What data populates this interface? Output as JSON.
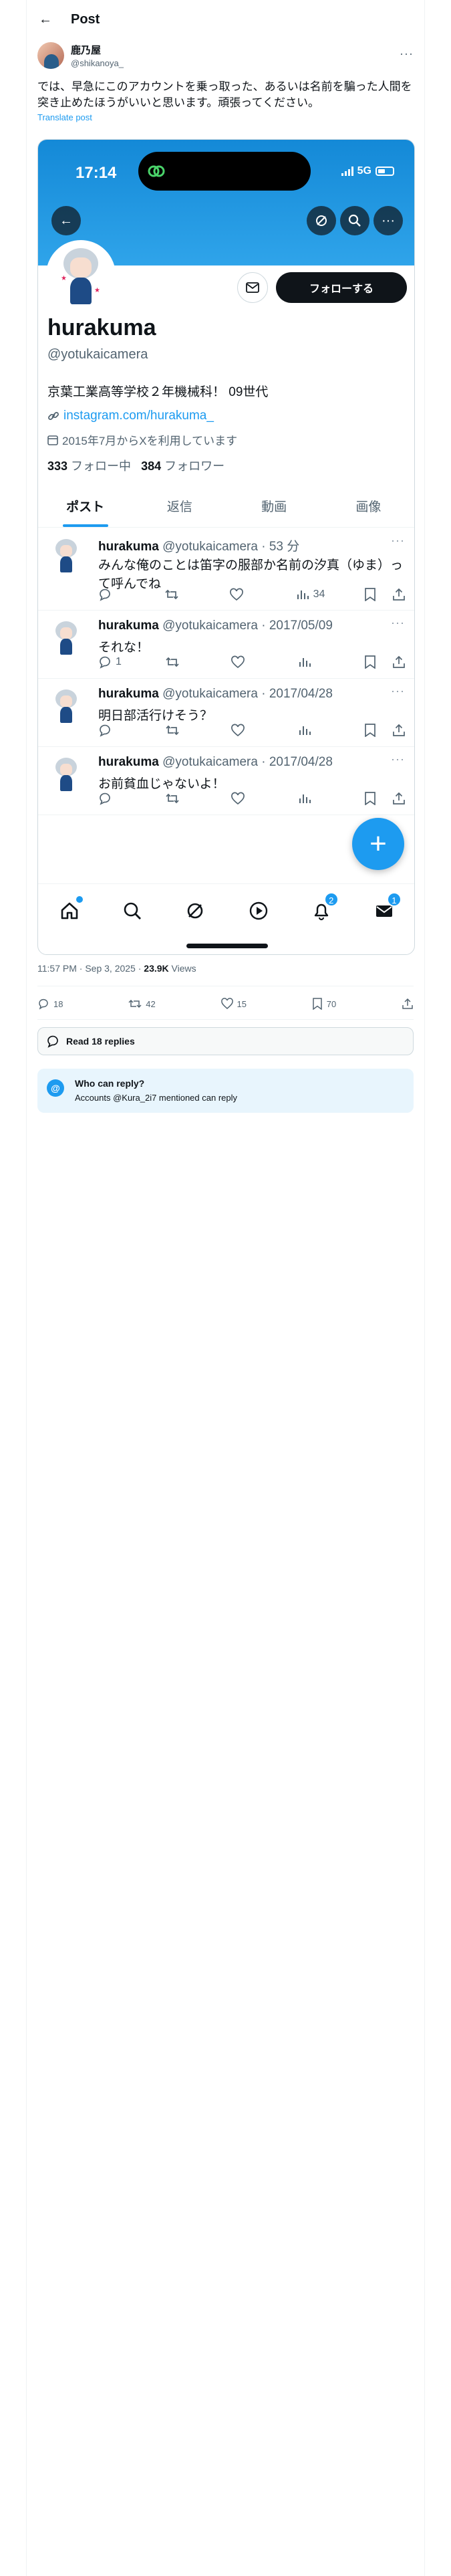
{
  "header": {
    "title": "Post"
  },
  "author": {
    "display_name": "鹿乃屋",
    "username": "@shikanoya_"
  },
  "post": {
    "text": "では、早急にこのアカウントを乗っ取った、あるいは名前を騙った人間を突き止めたほうがいいと思います。頑張ってください。",
    "translate_label": "Translate post",
    "timestamp": "11:57 PM · Sep 3, 2025 · ",
    "views_count": "23.9K",
    "views_label": " Views",
    "replies": "18",
    "reposts": "42",
    "likes": "15",
    "bookmarks": "70"
  },
  "read_replies": "Read 18 replies",
  "who_can_reply": {
    "title": "Who can reply?",
    "detail": "Accounts @Kura_2i7 mentioned can reply"
  },
  "screenshot": {
    "status_time": "17:14",
    "network": "5G",
    "profile": {
      "name": "hurakuma",
      "handle": "@yotukaicamera",
      "follow_label": "フォローする",
      "bio": "京葉工業高等学校２年機械科！ 09世代",
      "link": "instagram.com/hurakuma_",
      "joined": "2015年7月からXを利用しています",
      "following_count": "333",
      "following_label": " フォロー中",
      "followers_count": "384",
      "followers_label": " フォロワー"
    },
    "tabs": [
      "ポスト",
      "返信",
      "動画",
      "画像"
    ],
    "tweets": [
      {
        "name": "hurakuma",
        "meta": " @yotukaicamera · 53 分",
        "text": "みんな俺のことは笛字の服部か名前の汐真（ゆま）って呼んでね",
        "replies": "",
        "views": "34"
      },
      {
        "name": "hurakuma",
        "meta": " @yotukaicamera · 2017/05/09",
        "text": "それな！",
        "replies": "1",
        "views": ""
      },
      {
        "name": "hurakuma",
        "meta": " @yotukaicamera · 2017/04/28",
        "text": "明日部活行けそう？",
        "replies": "",
        "views": ""
      },
      {
        "name": "hurakuma",
        "meta": " @yotukaicamera · 2017/04/28",
        "text": "お前貧血じゃないよ！",
        "replies": "",
        "views": ""
      }
    ],
    "notif_badge": "2",
    "messages_badge": "1"
  },
  "colors": {
    "accent": "#1d9bf0",
    "banner": "#1b93de",
    "text": "#0f1419",
    "muted": "#536471"
  },
  "icons": [
    "back-arrow-icon",
    "more-icon",
    "search-icon",
    "grok-icon",
    "mail-icon",
    "link-icon",
    "calendar-icon",
    "reply-icon",
    "repost-icon",
    "like-icon",
    "views-icon",
    "bookmark-icon",
    "share-icon",
    "home-icon",
    "play-icon",
    "bell-icon",
    "envelope-icon",
    "plus-icon"
  ]
}
